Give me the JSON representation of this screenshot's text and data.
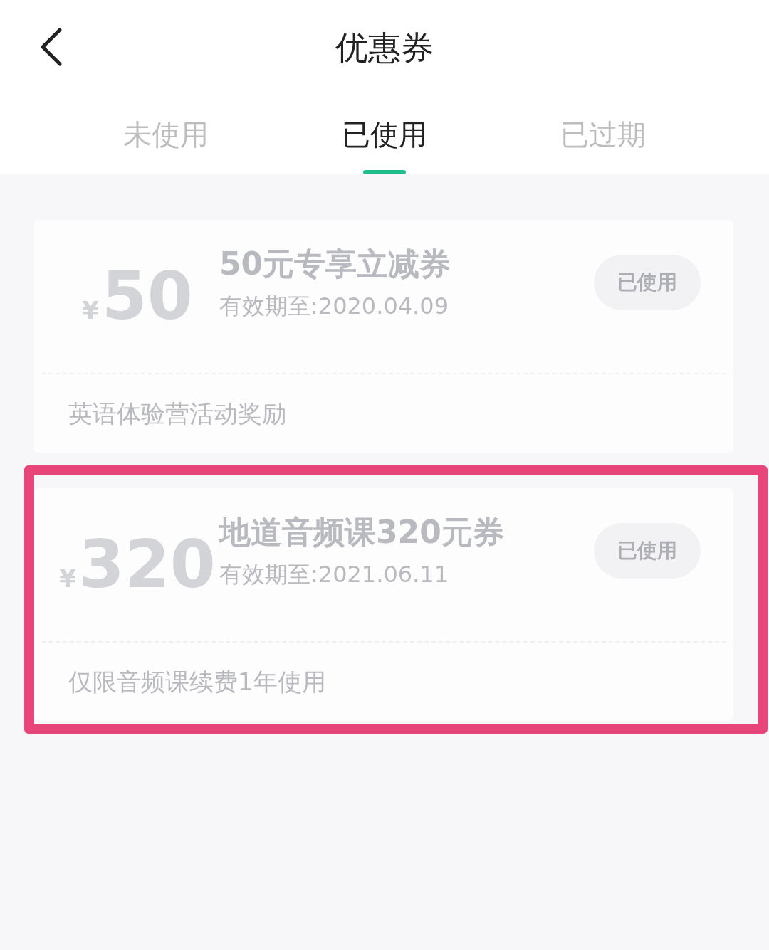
{
  "header": {
    "title": "优惠券"
  },
  "tabs": [
    {
      "label": "未使用",
      "selected": false
    },
    {
      "label": "已使用",
      "selected": true
    },
    {
      "label": "已过期",
      "selected": false
    }
  ],
  "coupons": [
    {
      "currency": "¥",
      "amount": "50",
      "title": "50元专享立减券",
      "validity": "有效期至:2020.04.09",
      "status": "已使用",
      "note": "英语体验营活动奖励",
      "highlighted": false
    },
    {
      "currency": "¥",
      "amount": "320",
      "title": "地道音频课320元券",
      "validity": "有效期至:2021.06.11",
      "status": "已使用",
      "note": "仅限音频课续费1年使用",
      "highlighted": true
    }
  ]
}
